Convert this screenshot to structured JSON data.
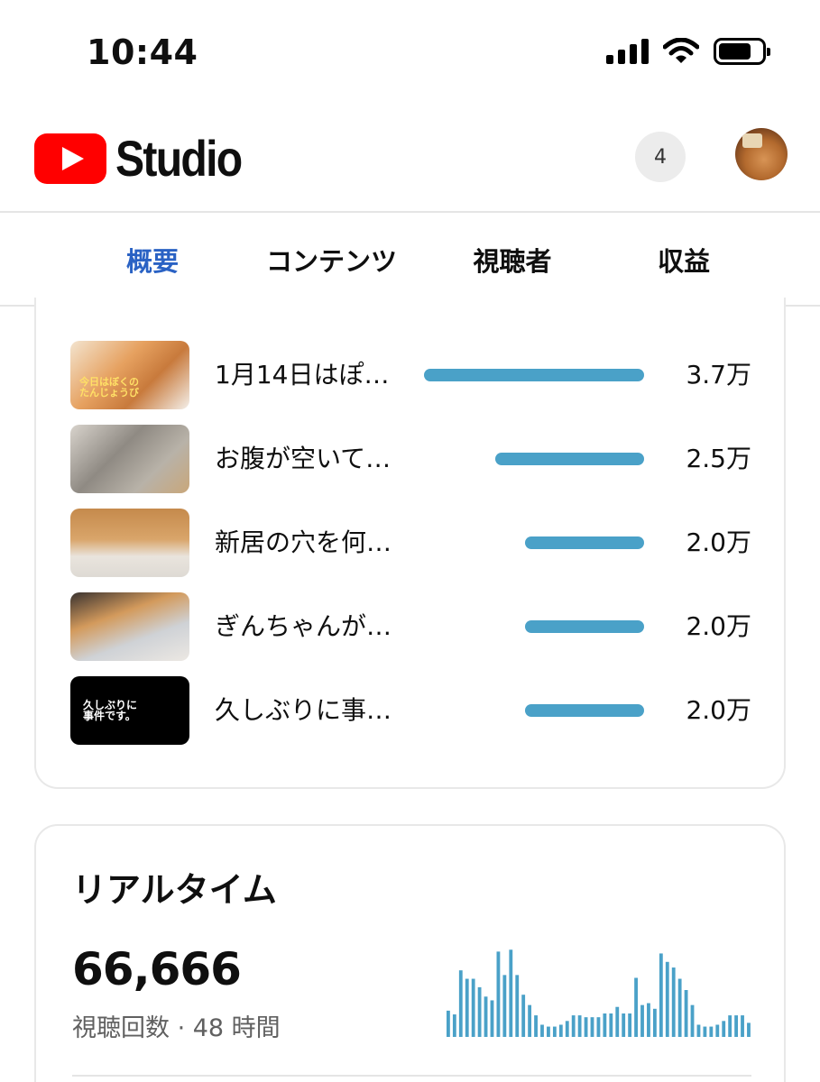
{
  "status_bar": {
    "time": "10:44",
    "battery_level": 0.75
  },
  "header": {
    "logo_text": "Studio",
    "notification_count": "4"
  },
  "tabs": [
    {
      "label": "概要",
      "active": true
    },
    {
      "label": "コンテンツ",
      "active": false
    },
    {
      "label": "視聴者",
      "active": false
    },
    {
      "label": "収益",
      "active": false
    }
  ],
  "top_videos": [
    {
      "title": "1月14日はぽ…",
      "value": "3.7万",
      "views": 37000,
      "thumb_text": "今日はぼくの\nたんじょうび"
    },
    {
      "title": "お腹が空いて…",
      "value": "2.5万",
      "views": 25000,
      "thumb_text": ""
    },
    {
      "title": "新居の穴を何…",
      "value": "2.0万",
      "views": 20000,
      "thumb_text": ""
    },
    {
      "title": "ぎんちゃんが…",
      "value": "2.0万",
      "views": 20000,
      "thumb_text": ""
    },
    {
      "title": "久しぶりに事…",
      "value": "2.0万",
      "views": 20000,
      "thumb_text": "久しぶりに\n事件です。"
    }
  ],
  "realtime": {
    "title": "リアルタイム",
    "count": "66,666",
    "subtitle": "視聴回数 · 48 時間"
  },
  "chart_data": {
    "type": "bar",
    "title": "",
    "xlabel": "",
    "ylabel": "",
    "ylim": [
      0,
      100
    ],
    "values": [
      28,
      24,
      71,
      62,
      62,
      53,
      43,
      39,
      91,
      66,
      93,
      66,
      45,
      34,
      23,
      13,
      11,
      11,
      13,
      17,
      23,
      23,
      21,
      21,
      21,
      25,
      25,
      32,
      25,
      25,
      63,
      34,
      36,
      30,
      89,
      80,
      74,
      62,
      50,
      34,
      13,
      11,
      11,
      13,
      17,
      23,
      23,
      23,
      15
    ]
  }
}
